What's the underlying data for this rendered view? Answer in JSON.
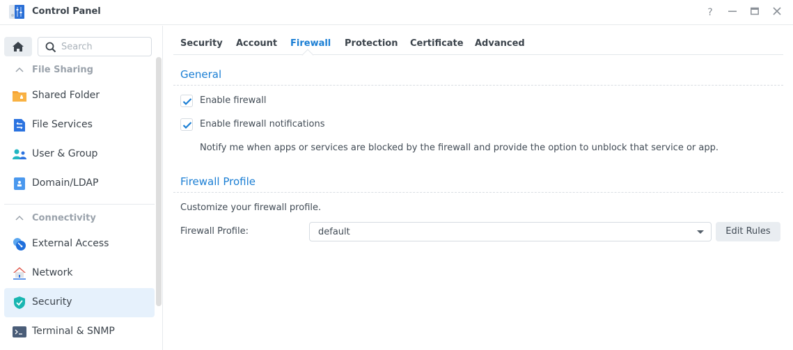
{
  "window": {
    "title": "Control Panel",
    "controls": {
      "help": "?",
      "minimize": "–",
      "maximize": "▭",
      "close": "✕"
    }
  },
  "sidebar": {
    "search": {
      "placeholder": "Search",
      "value": ""
    },
    "groups": [
      {
        "label": "File Sharing",
        "items": [
          {
            "label": "Shared Folder",
            "icon": "shared-folder-icon"
          },
          {
            "label": "File Services",
            "icon": "file-services-icon"
          },
          {
            "label": "User & Group",
            "icon": "user-group-icon"
          },
          {
            "label": "Domain/LDAP",
            "icon": "domain-ldap-icon"
          }
        ]
      },
      {
        "label": "Connectivity",
        "items": [
          {
            "label": "External Access",
            "icon": "external-access-icon"
          },
          {
            "label": "Network",
            "icon": "network-icon"
          },
          {
            "label": "Security",
            "icon": "security-shield-icon",
            "active": true
          },
          {
            "label": "Terminal & SNMP",
            "icon": "terminal-icon"
          }
        ]
      }
    ]
  },
  "tabs": [
    {
      "label": "Security"
    },
    {
      "label": "Account"
    },
    {
      "label": "Firewall",
      "active": true
    },
    {
      "label": "Protection"
    },
    {
      "label": "Certificate"
    },
    {
      "label": "Advanced"
    }
  ],
  "general": {
    "title": "General",
    "enable_firewall": {
      "label": "Enable firewall",
      "checked": true
    },
    "enable_notifications": {
      "label": "Enable firewall notifications",
      "checked": true
    },
    "notifications_desc": "Notify me when apps or services are blocked by the firewall and provide the option to unblock that service or app."
  },
  "profile": {
    "title": "Firewall Profile",
    "description": "Customize your firewall profile.",
    "field_label": "Firewall Profile:",
    "selected": "default",
    "edit_button": "Edit Rules"
  },
  "colors": {
    "accent": "#1a7ed4",
    "active_item_bg": "#e6f1fc",
    "button_bg": "#e9edf1"
  }
}
